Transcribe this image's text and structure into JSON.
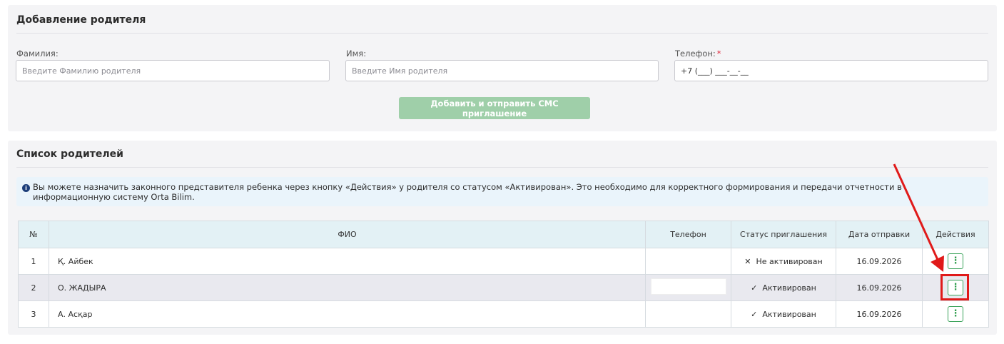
{
  "add_parent": {
    "title": "Добавление родителя",
    "surname_label": "Фамилия:",
    "surname_placeholder": "Введите Фамилию родителя",
    "name_label": "Имя:",
    "name_placeholder": "Введите Имя родителя",
    "phone_label": "Телефон:",
    "phone_required_mark": "*",
    "phone_value": "+7 (___) ___-__-__",
    "submit_label": "Добавить и отправить СМС приглашение"
  },
  "parents_list": {
    "title": "Список родителей",
    "info_icon": "info-icon",
    "info_text": "Вы можете назначить законного представителя ребенка через кнопку «Действия» у родителя со статусом «Активирован». Это необходимо для корректного формирования и передачи отчетности в информационную систему Orta Bilim.",
    "columns": [
      "№",
      "ФИО",
      "Телефон",
      "Статус приглашения",
      "Дата отправки",
      "Действия"
    ],
    "rows": [
      {
        "num": "1",
        "fio": "Қ. Айбек",
        "phone": "",
        "status_icon": "✕",
        "status": "Не активирован",
        "date": "16.09.2026",
        "action": "⋮"
      },
      {
        "num": "2",
        "fio": "О. ЖАДЫРА",
        "phone": "",
        "status_icon": "✓",
        "status": "Активирован",
        "date": "16.09.2026",
        "action": "⋮"
      },
      {
        "num": "3",
        "fio": "А. Асқар",
        "phone": "",
        "status_icon": "✓",
        "status": "Активирован",
        "date": "16.09.2026",
        "action": "⋮"
      }
    ]
  },
  "colors": {
    "accent_green": "#2e9c4c",
    "button_disabled": "#9fcfa9",
    "annotation_red": "#e01a1a",
    "table_header": "#e3f1f5",
    "info_bg": "#eaf4fb"
  }
}
